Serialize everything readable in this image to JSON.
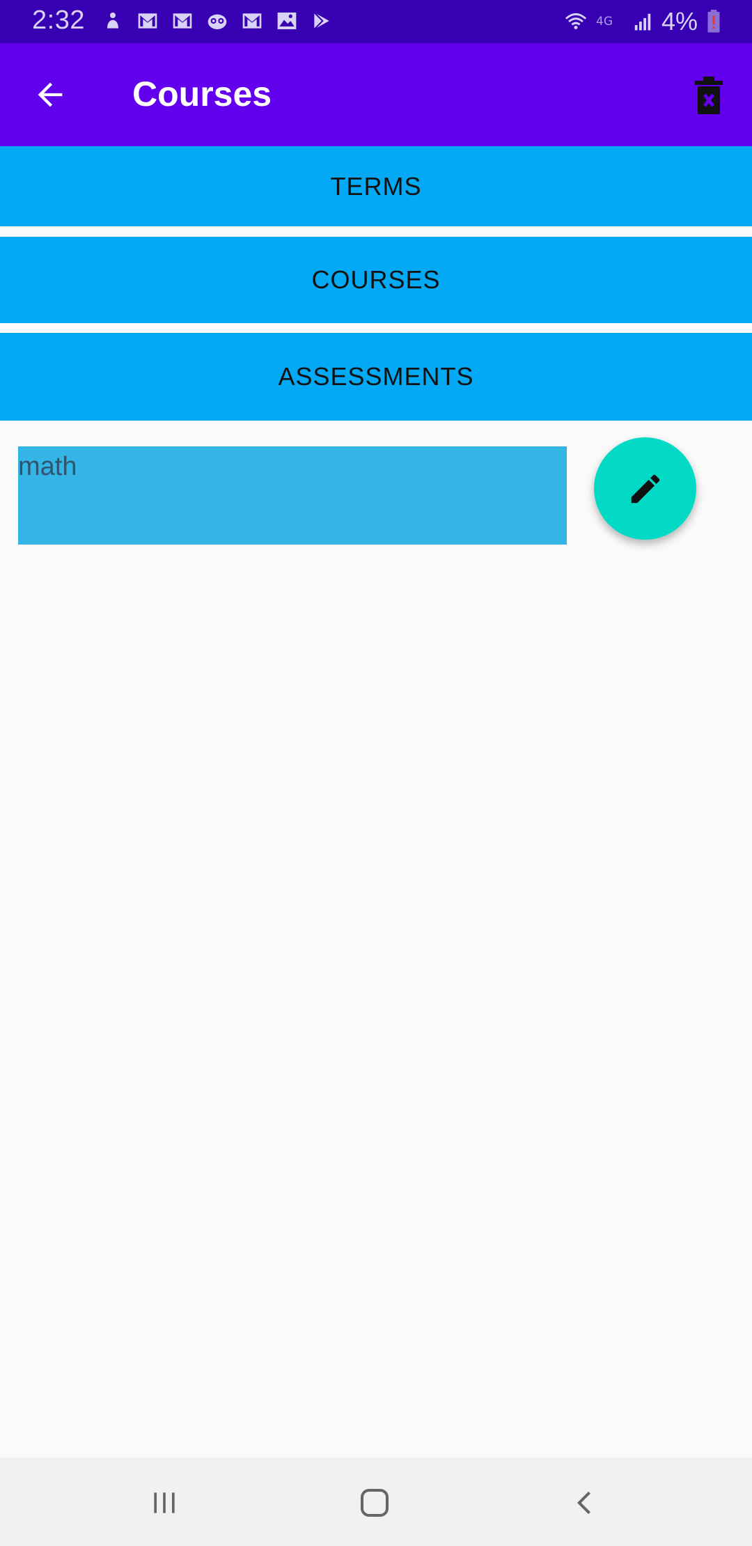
{
  "status_bar": {
    "time": "2:32",
    "battery_percent": "4%",
    "notification_icons": [
      "person-icon",
      "gmail-icon",
      "gmail-icon",
      "owl-icon",
      "gmail-icon",
      "gallery-icon",
      "play-store-icon"
    ],
    "right_icons": [
      "wifi-icon",
      "4g-icon",
      "signal-icon",
      "battery-low-icon"
    ]
  },
  "app_bar": {
    "title": "Courses",
    "back_icon": "arrow-back-icon",
    "action_icon": "delete-icon"
  },
  "buttons": {
    "terms": "TERMS",
    "courses": "COURSES",
    "assessments": "ASSESSMENTS"
  },
  "list": {
    "items": [
      {
        "label": "math"
      }
    ]
  },
  "fab": {
    "icon": "edit-icon"
  },
  "navigation_bar": {
    "keys": [
      "recents-icon",
      "home-icon",
      "back-icon"
    ]
  },
  "colors": {
    "status_bar": "#3700b3",
    "app_bar": "#6200ee",
    "button": "#03a9f4",
    "list_item": "#35b5e5",
    "fab": "#03dac5",
    "background": "#fafafa"
  }
}
